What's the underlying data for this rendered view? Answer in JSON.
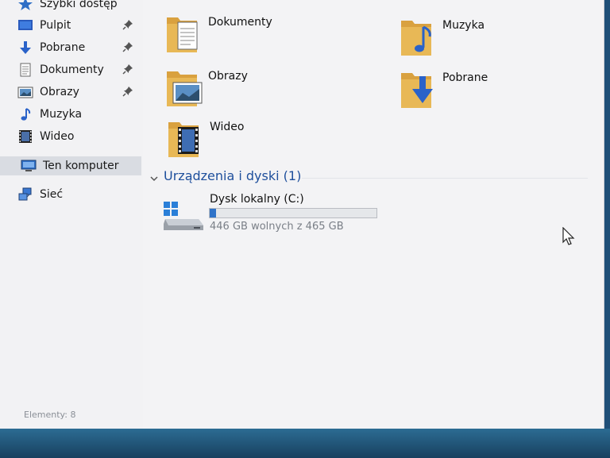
{
  "sidebar": {
    "quick_access": "Szybki dostęp",
    "items": [
      {
        "label": "Pulpit",
        "icon": "desktop-icon",
        "pinned": true
      },
      {
        "label": "Pobrane",
        "icon": "download-icon",
        "pinned": true
      },
      {
        "label": "Dokumenty",
        "icon": "document-icon",
        "pinned": true
      },
      {
        "label": "Obrazy",
        "icon": "picture-icon",
        "pinned": true
      },
      {
        "label": "Muzyka",
        "icon": "music-icon",
        "pinned": false
      },
      {
        "label": "Wideo",
        "icon": "video-icon",
        "pinned": false
      }
    ],
    "this_pc": "Ten komputer",
    "network": "Sieć"
  },
  "folders": [
    {
      "label": "Dokumenty",
      "icon": "documents-folder-icon"
    },
    {
      "label": "Muzyka",
      "icon": "music-folder-icon"
    },
    {
      "label": "Obrazy",
      "icon": "pictures-folder-icon"
    },
    {
      "label": "Pobrane",
      "icon": "downloads-folder-icon"
    },
    {
      "label": "Wideo",
      "icon": "videos-folder-icon"
    }
  ],
  "devices": {
    "header": "Urządzenia i dyski (1)",
    "drives": [
      {
        "name": "Dysk lokalny (C:)",
        "free_text": "446 GB wolnych z 465 GB",
        "used_fraction": 0.04
      }
    ]
  },
  "status": {
    "items_count": "Elementy: 8"
  },
  "colors": {
    "accent": "#2f73c9",
    "folder": "#e2b04a",
    "section_header": "#1e4f9c"
  }
}
